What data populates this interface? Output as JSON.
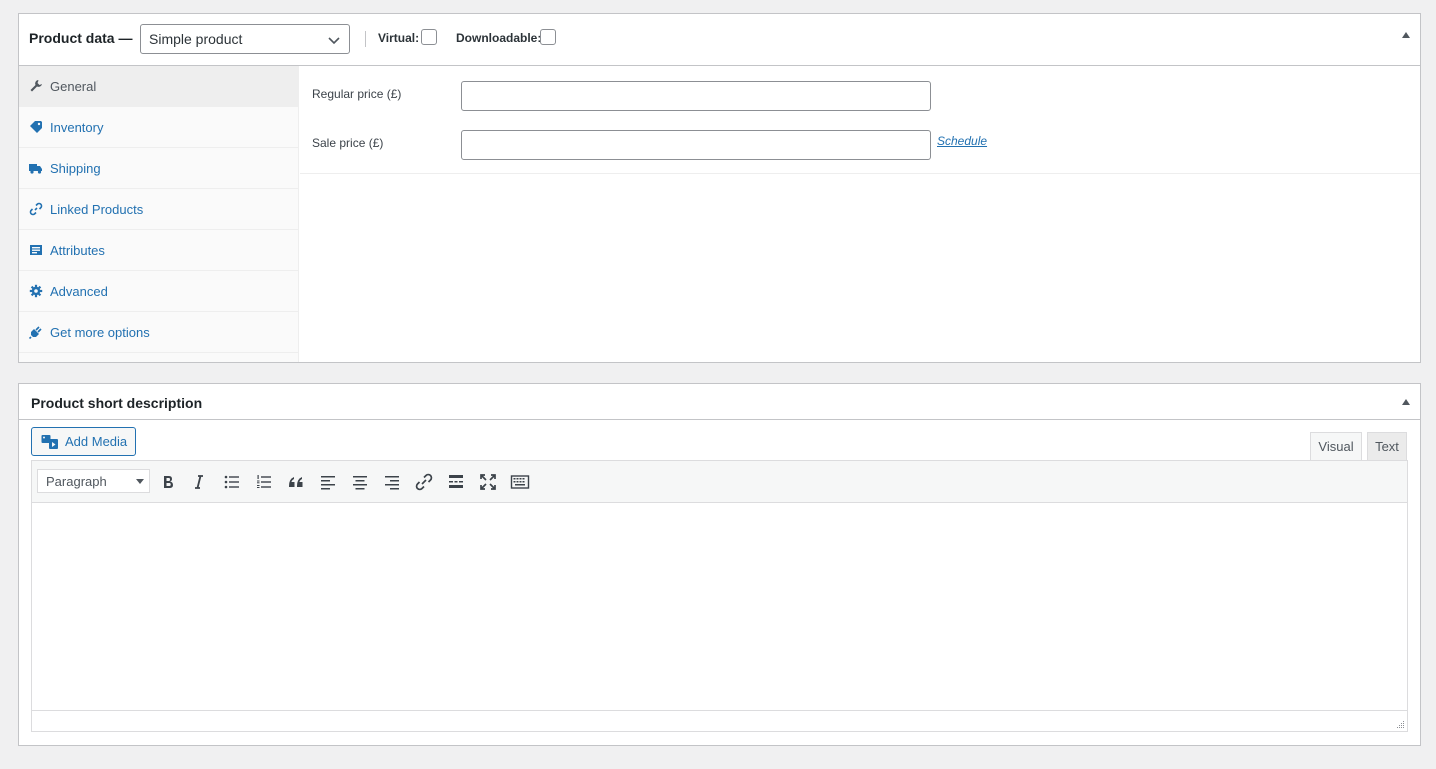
{
  "product_data": {
    "title": "Product data —",
    "product_type": "Simple product",
    "virtual_label": "Virtual:",
    "downloadable_label": "Downloadable:",
    "tabs": [
      {
        "label": "General",
        "icon": "wrench-icon"
      },
      {
        "label": "Inventory",
        "icon": "tag-icon"
      },
      {
        "label": "Shipping",
        "icon": "truck-icon"
      },
      {
        "label": "Linked Products",
        "icon": "link-icon"
      },
      {
        "label": "Attributes",
        "icon": "list-icon"
      },
      {
        "label": "Advanced",
        "icon": "gear-icon"
      },
      {
        "label": "Get more options",
        "icon": "plugin-icon"
      }
    ],
    "active_tab": "General",
    "regular_price_label": "Regular price (£)",
    "regular_price_value": "",
    "sale_price_label": "Sale price (£)",
    "sale_price_value": "",
    "schedule_link": "Schedule"
  },
  "short_description": {
    "title": "Product short description",
    "add_media_label": "Add Media",
    "visual_tab": "Visual",
    "text_tab": "Text",
    "format_select": "Paragraph",
    "content": ""
  },
  "colors": {
    "link": "#2271b1",
    "border": "#c3c4c7",
    "background": "#f0f0f1"
  }
}
